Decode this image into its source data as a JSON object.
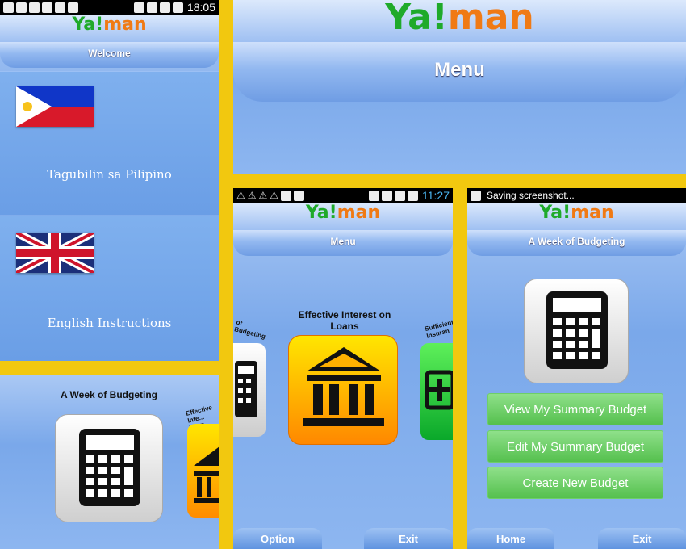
{
  "panel1": {
    "status_time": "18:05",
    "logo": {
      "ya": "Ya",
      "bang": "!",
      "man": "man"
    },
    "header": "Welcome",
    "languages": [
      {
        "label": "Tagubilin sa Pilipino",
        "flag": "philippines-flag-icon"
      },
      {
        "label": "English Instructions",
        "flag": "uk-flag-icon"
      }
    ]
  },
  "panel2": {
    "logo": {
      "ya": "Ya",
      "bang": "!",
      "man": "man"
    },
    "header": "Menu"
  },
  "panel3": {
    "title": "A Week of Budgeting",
    "side_label": "Effective Inte... Loan"
  },
  "panel4": {
    "status_time": "11:27",
    "logo": {
      "ya": "Ya",
      "bang": "!",
      "man": "man"
    },
    "header": "Menu",
    "left_label": "of Budgeting",
    "center_label": "Effective Interest on Loans",
    "right_label": "Sufficient Insuran",
    "footer": {
      "left": "Option",
      "right": "Exit"
    }
  },
  "panel5": {
    "status_text": "Saving screenshot...",
    "logo": {
      "ya": "Ya",
      "bang": "!",
      "man": "man"
    },
    "header": "A Week of Budgeting",
    "buttons": [
      "View My Summary Budget",
      "Edit My Summary Budget",
      "Create New Budget"
    ],
    "footer": {
      "left": "Home",
      "right": "Exit"
    }
  },
  "colors": {
    "frame": "#f2c80f",
    "accent_green": "#1faa2a",
    "accent_orange": "#f07a14",
    "button_green": "#55c04e"
  }
}
